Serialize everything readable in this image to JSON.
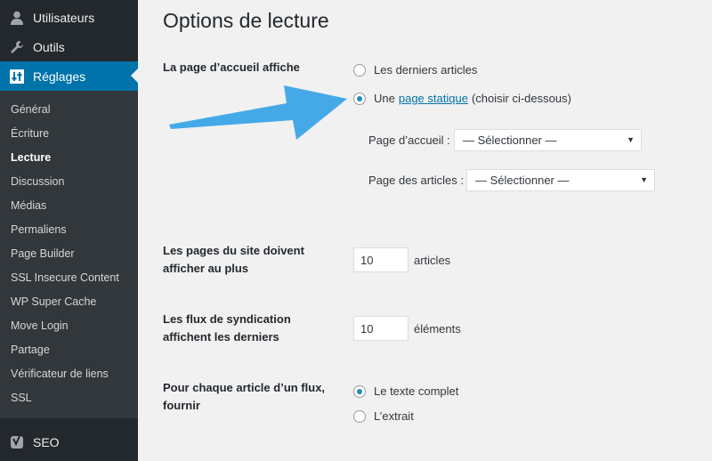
{
  "sidebar": {
    "top_items": [
      {
        "label": "Utilisateurs",
        "icon": "user-icon"
      },
      {
        "label": "Outils",
        "icon": "wrench-icon"
      },
      {
        "label": "Réglages",
        "icon": "settings-sliders-icon",
        "active": true
      }
    ],
    "submenu": [
      "Général",
      "Écriture",
      "Lecture",
      "Discussion",
      "Médias",
      "Permaliens",
      "Page Builder",
      "SSL Insecure Content",
      "WP Super Cache",
      "Move Login",
      "Partage",
      "Vérificateur de liens",
      "SSL"
    ],
    "current_submenu": "Lecture",
    "seo": {
      "label": "SEO",
      "icon": "yoast-icon"
    }
  },
  "colors": {
    "sidebar_bg": "#23282d",
    "submenu_bg": "#32373c",
    "active_bg": "#0073aa",
    "link": "#0073aa",
    "arrow": "#45a9e8"
  },
  "page": {
    "title": "Options de lecture",
    "front_page": {
      "label": "La page d’accueil affiche",
      "option_latest": "Les derniers articles",
      "option_static_prefix": "Une",
      "option_static_link": "page statique",
      "option_static_suffix": "(choisir ci-dessous)",
      "selected": "static",
      "homepage_label": "Page d’accueil :",
      "homepage_value": "— Sélectionner —",
      "posts_page_label": "Page des articles :",
      "posts_page_value": "— Sélectionner —"
    },
    "posts_per_page": {
      "label_line1": "Les pages du site doivent",
      "label_line2": "afficher au plus",
      "value": "10",
      "unit": "articles"
    },
    "feed_items": {
      "label_line1": "Les flux de syndication",
      "label_line2": "affichent les derniers",
      "value": "10",
      "unit": "éléments"
    },
    "feed_content": {
      "label_line1": "Pour chaque article d’un flux,",
      "label_line2": "fournir",
      "option_full": "Le texte complet",
      "option_excerpt": "L’extrait",
      "selected": "full"
    }
  }
}
